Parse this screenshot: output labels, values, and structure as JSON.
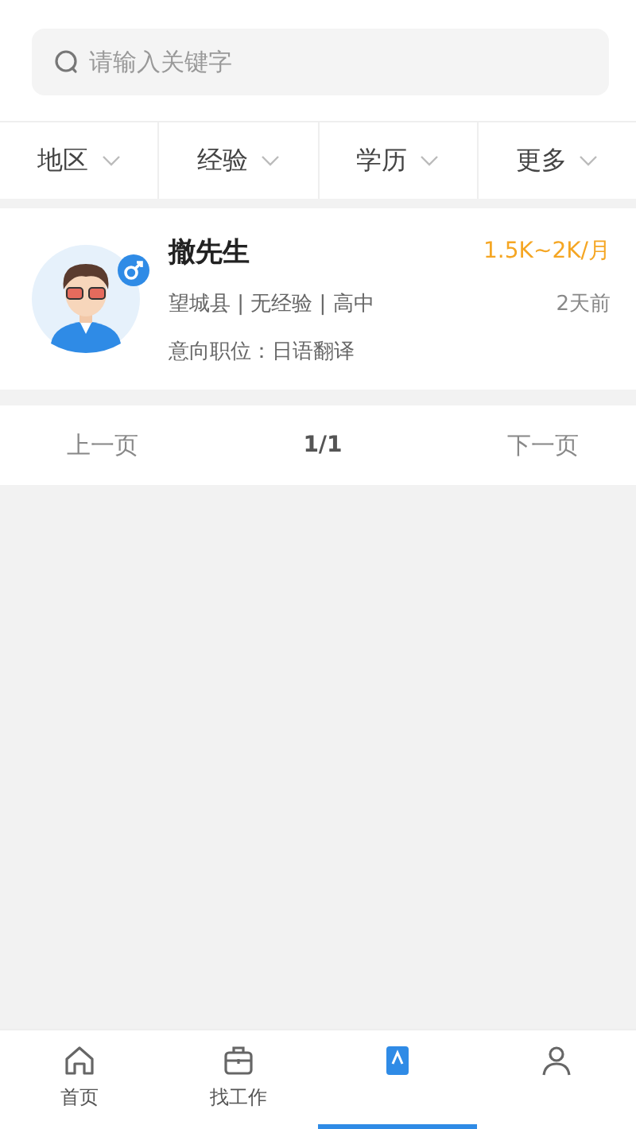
{
  "search": {
    "placeholder": "请输入关键字"
  },
  "filters": [
    {
      "label": "地区"
    },
    {
      "label": "经验"
    },
    {
      "label": "学历"
    },
    {
      "label": "更多"
    }
  ],
  "candidates": [
    {
      "name": "撤先生",
      "salary": "1.5K~2K/月",
      "details": "望城县 | 无经验 | 高中",
      "posted": "2天前",
      "intent": "意向职位：日语翻译"
    }
  ],
  "pagination": {
    "prev": "上一页",
    "page": "1/1",
    "next": "下一页"
  },
  "bottom_nav": [
    {
      "label": "首页",
      "selected": false
    },
    {
      "label": "找工作",
      "selected": false
    },
    {
      "selected": true
    },
    {
      "selected": false
    }
  ]
}
